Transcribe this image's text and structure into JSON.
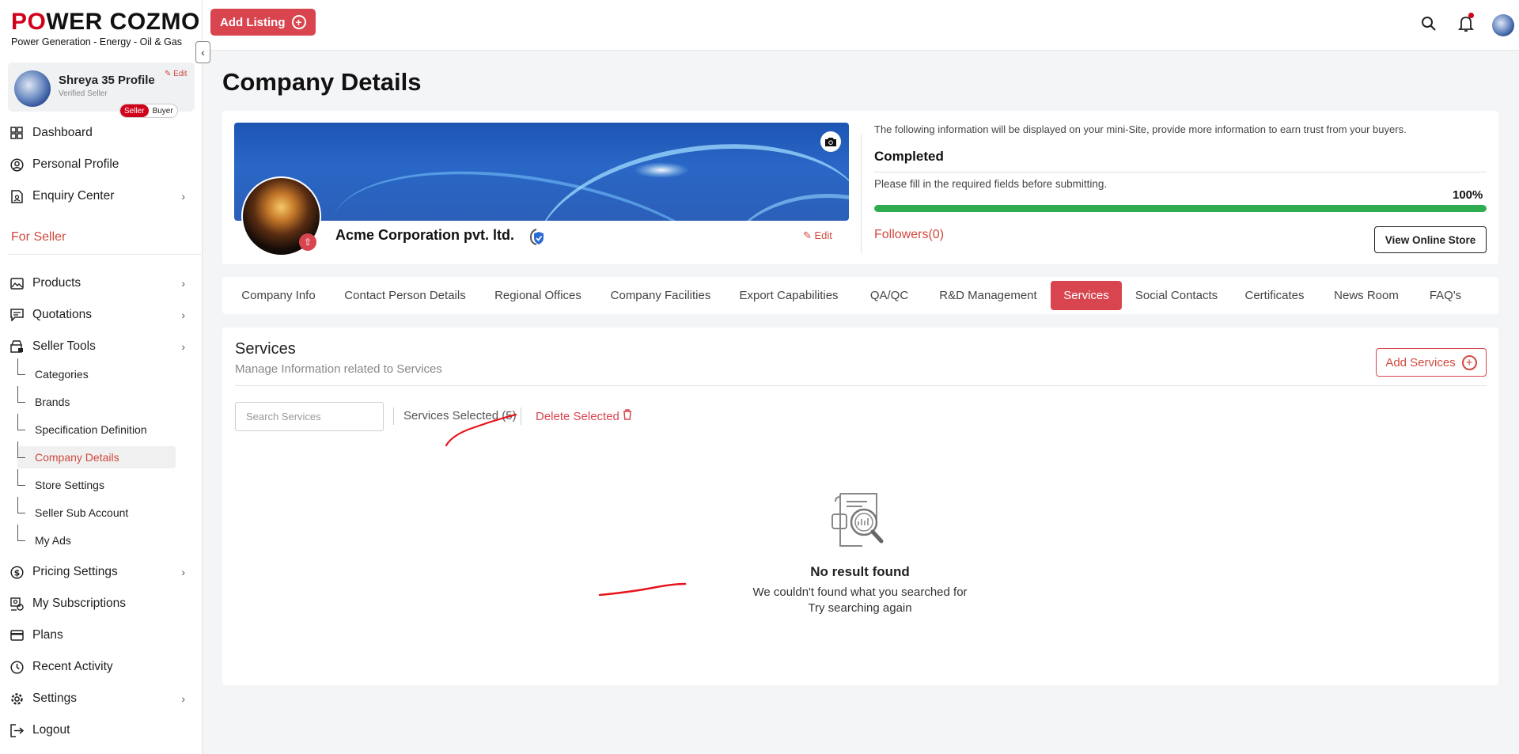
{
  "brand": {
    "logo_part1": "P",
    "logo_o": "O",
    "logo_part2": "WER COZMO",
    "tagline": "Power Generation - Energy - Oil & Gas"
  },
  "profile": {
    "name": "Shreya 35 Profile",
    "status": "Verified Seller",
    "edit_label": "Edit",
    "role_seller": "Seller",
    "role_buyer": "Buyer"
  },
  "sidebar": {
    "top_items": [
      {
        "label": "Dashboard",
        "icon": "dashboard-icon"
      },
      {
        "label": "Personal Profile",
        "icon": "user-circle-icon"
      },
      {
        "label": "Enquiry Center",
        "icon": "enquiry-icon"
      }
    ],
    "section_label": "For Seller",
    "seller_items": [
      {
        "label": "Products",
        "icon": "image-icon"
      },
      {
        "label": "Quotations",
        "icon": "quotation-icon"
      },
      {
        "label": "Seller Tools",
        "icon": "tools-icon"
      }
    ],
    "seller_tools_sub": [
      "Categories",
      "Brands",
      "Specification Definition",
      "Company Details",
      "Store Settings",
      "Seller Sub Account",
      "My Ads"
    ],
    "bottom_items": [
      {
        "label": "Pricing Settings",
        "icon": "dollar-icon"
      },
      {
        "label": "My Subscriptions",
        "icon": "subscription-icon"
      },
      {
        "label": "Plans",
        "icon": "card-icon"
      },
      {
        "label": "Recent Activity",
        "icon": "clock-icon"
      },
      {
        "label": "Settings",
        "icon": "gear-icon"
      },
      {
        "label": "Logout",
        "icon": "logout-icon"
      }
    ]
  },
  "topbar": {
    "add_listing_label": "Add Listing"
  },
  "page": {
    "title": "Company Details"
  },
  "company": {
    "name": "Acme Corporation pvt. ltd.",
    "edit_label": "Edit",
    "info_text": "The following information will be displayed on your mini-Site, provide more information to earn trust from your buyers.",
    "status": "Completed",
    "fill_text": "Please fill in the required fields before submitting.",
    "progress_label": "100%",
    "progress_value": 1.0,
    "followers_label": "Followers(0)",
    "view_store_label": "View Online Store"
  },
  "tabs": [
    "Company Info",
    "Contact Person Details",
    "Regional Offices",
    "Company Facilities",
    "Export Capabilities",
    "QA/QC",
    "R&D Management",
    "Services",
    "Social Contacts",
    "Certificates",
    "News Room",
    "FAQ's"
  ],
  "active_tab": "Services",
  "services": {
    "title": "Services",
    "subtitle": "Manage Information related to Services",
    "add_label": "Add Services",
    "search_placeholder": "Search Services",
    "selected_label": "Services Selected (5)",
    "delete_label": "Delete Selected",
    "empty_title": "No result found",
    "empty_line1": "We couldn't found what you searched for",
    "empty_line2": "Try searching again"
  },
  "colors": {
    "accent": "#d9454f",
    "brand_red": "#d0021b",
    "progress": "#2fac4f",
    "annotation": "#e8141c"
  }
}
